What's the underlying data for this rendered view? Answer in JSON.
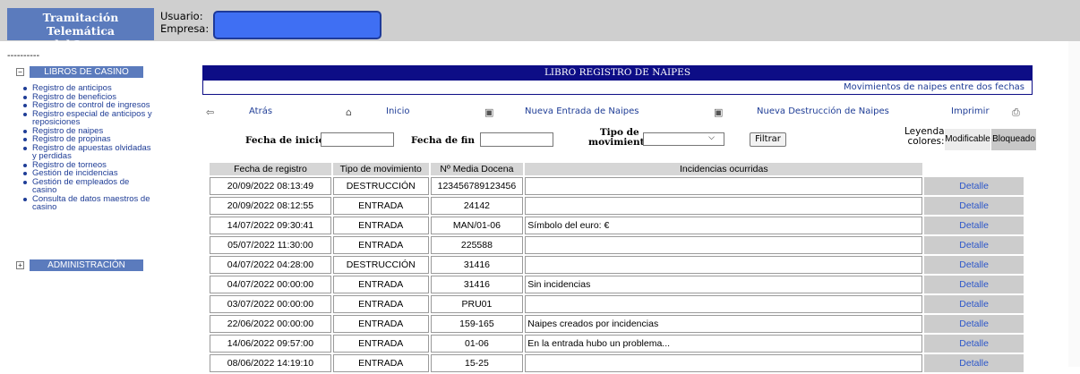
{
  "header": {
    "brand_line1": "Tramitación Telemática",
    "brand_line2": "del Juego",
    "user_label": "Usuario:",
    "company_label": "Empresa:"
  },
  "sidebar": {
    "separator": "----------",
    "section1": {
      "toggle": "−",
      "title": "LIBROS DE CASINO"
    },
    "items": [
      "Registro de anticipos",
      "Registro de beneficios",
      "Registro de control de ingresos",
      "Registro especial de anticipos y reposiciones",
      "Registro de naipes",
      "Registro de propinas",
      "Registro de apuestas olvidadas y perdidas",
      "Registro de torneos",
      "Gestión de incidencias",
      "Gestión de empleados de casino",
      "Consulta de datos maestros de casino"
    ],
    "section2": {
      "toggle": "+",
      "title": "ADMINISTRACIÓN"
    }
  },
  "panel": {
    "title": "LIBRO REGISTRO DE NAIPES",
    "subtitle": "Movimientos de naipes entre dos fechas"
  },
  "actions": {
    "back": "Atrás",
    "home": "Inicio",
    "new_entry": "Nueva Entrada de Naipes",
    "new_destruction": "Nueva Destrucción de Naipes",
    "print": "Imprimir"
  },
  "filters": {
    "start_label": "Fecha de inicio",
    "start_value": "",
    "end_label": "Fecha de fin",
    "end_value": "",
    "type_label_1": "Tipo de",
    "type_label_2": "movimiento",
    "type_selected": "",
    "filter_button": "Filtrar"
  },
  "legend": {
    "label_1": "Leyenda",
    "label_2": "colores:",
    "modifiable": "Modificable",
    "blocked": "Bloqueado"
  },
  "table": {
    "headers": [
      "Fecha de registro",
      "Tipo de movimiento",
      "Nº Media Docena",
      "Incidencias ocurridas"
    ],
    "detail_label": "Detalle",
    "rows": [
      {
        "date": "20/09/2022 08:13:49",
        "type": "DESTRUCCIÓN",
        "number": "123456789123456",
        "incidents": ""
      },
      {
        "date": "20/09/2022 08:12:55",
        "type": "ENTRADA",
        "number": "24142",
        "incidents": ""
      },
      {
        "date": "14/07/2022 09:30:41",
        "type": "ENTRADA",
        "number": "MAN/01-06",
        "incidents": "Símbolo del euro: €"
      },
      {
        "date": "05/07/2022 11:30:00",
        "type": "ENTRADA",
        "number": "225588",
        "incidents": ""
      },
      {
        "date": "04/07/2022 04:28:00",
        "type": "DESTRUCCIÓN",
        "number": "31416",
        "incidents": ""
      },
      {
        "date": "04/07/2022 00:00:00",
        "type": "ENTRADA",
        "number": "31416",
        "incidents": "Sin incidencias"
      },
      {
        "date": "03/07/2022 00:00:00",
        "type": "ENTRADA",
        "number": "PRU01",
        "incidents": ""
      },
      {
        "date": "22/06/2022 00:00:00",
        "type": "ENTRADA",
        "number": "159-165",
        "incidents": "Naipes creados por incidencias"
      },
      {
        "date": "14/06/2022 09:57:00",
        "type": "ENTRADA",
        "number": "01-06",
        "incidents": "En la entrada hubo un problema..."
      },
      {
        "date": "08/06/2022 14:19:10",
        "type": "ENTRADA",
        "number": "15-25",
        "incidents": ""
      }
    ]
  }
}
